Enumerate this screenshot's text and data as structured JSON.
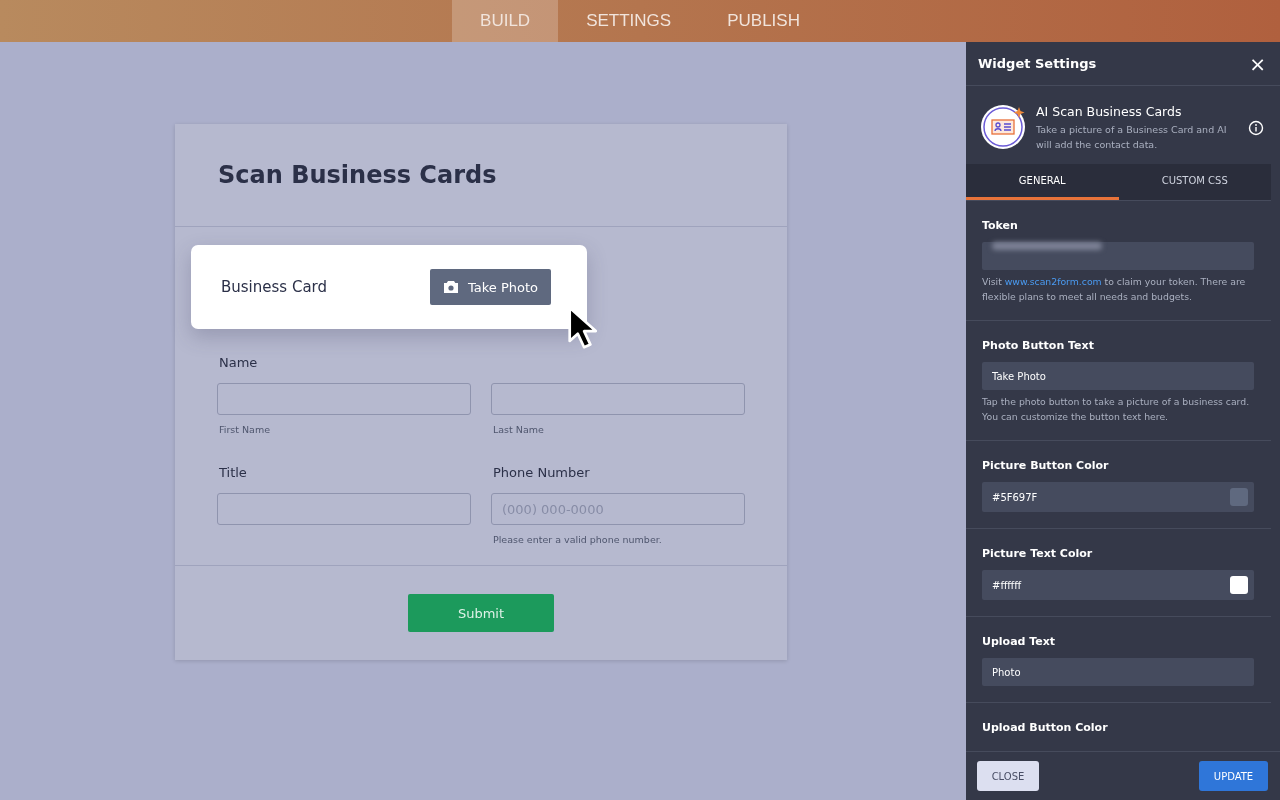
{
  "top_tabs": [
    {
      "label": "BUILD",
      "selected": true
    },
    {
      "label": "SETTINGS",
      "selected": false
    },
    {
      "label": "PUBLISH",
      "selected": false
    }
  ],
  "form": {
    "title": "Scan Business Cards",
    "scan_field": {
      "label": "Business Card",
      "button": "Take Photo"
    },
    "name": {
      "label": "Name",
      "first_sublabel": "First Name",
      "last_sublabel": "Last Name"
    },
    "title_field": {
      "label": "Title"
    },
    "phone": {
      "label": "Phone Number",
      "placeholder": "(000) 000-0000",
      "hint": "Please enter a valid phone number."
    },
    "submit": "Submit"
  },
  "panel": {
    "title": "Widget Settings",
    "close_icon": "×",
    "widget": {
      "name": "AI Scan Business Cards",
      "description": "Take a picture of a Business Card and AI will add the contact data."
    },
    "tabs": [
      {
        "label": "GENERAL",
        "selected": true
      },
      {
        "label": "CUSTOM CSS",
        "selected": false
      }
    ],
    "settings": [
      {
        "kind": "secret",
        "label": "Token",
        "help_before": "Visit ",
        "link": "www.scan2form.com",
        "help_after": " to claim your token. There are flexible plans to meet all needs and budgets."
      },
      {
        "kind": "text",
        "label": "Photo Button Text",
        "value": "Take Photo",
        "help": "Tap the photo button to take a picture of a business card. You can customize the button text here."
      },
      {
        "kind": "color",
        "label": "Picture Button Color",
        "value": "#5F697F",
        "color": "#5f697f"
      },
      {
        "kind": "color",
        "label": "Picture Text Color",
        "value": "#ffffff",
        "color": "#ffffff"
      },
      {
        "kind": "text",
        "label": "Upload Text",
        "value": "Photo"
      },
      {
        "kind": "heading",
        "label": "Upload Button Color"
      }
    ],
    "footer": {
      "close": "CLOSE",
      "update": "UPDATE"
    }
  }
}
